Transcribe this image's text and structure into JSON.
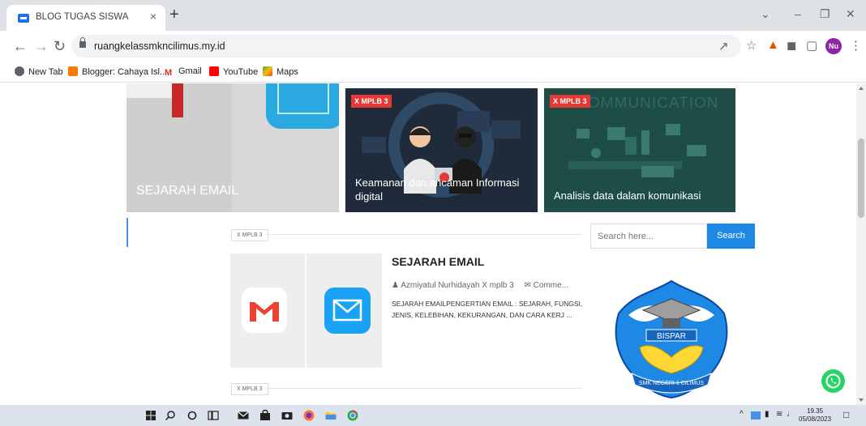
{
  "browser": {
    "tab_title": "BLOG TUGAS SISWA",
    "tab_close": "×",
    "new_tab": "+",
    "url": "ruangkelassmkncilimus.my.id",
    "profile_initials": "Nu",
    "bookmarks": [
      {
        "label": "New Tab",
        "icon": "globe-icon",
        "color": "#5f6368"
      },
      {
        "label": "Blogger: Cahaya Isl...",
        "icon": "blogger-icon",
        "color": "#f57c00"
      },
      {
        "label": "Gmail",
        "icon": "gmail-icon",
        "color": "#d93025"
      },
      {
        "label": "YouTube",
        "icon": "youtube-icon",
        "color": "#ff0000"
      },
      {
        "label": "Maps",
        "icon": "maps-icon",
        "color": "#34a853"
      }
    ]
  },
  "featured": [
    {
      "title": "SEJARAH EMAIL"
    },
    {
      "tag": "X MPLB 3",
      "title": "Keamanan dan ancaman Informasi digital"
    },
    {
      "tag": "X MPLB 3",
      "title": "Analisis data dalam komunikasi",
      "bg_word": "OMMUNICATION"
    }
  ],
  "section_label": "X MPLB 3",
  "search": {
    "placeholder": "Search here...",
    "button": "Search"
  },
  "post": {
    "title": "SEJARAH EMAIL",
    "author": "Azmiyatul Nurhidayah X mplb 3",
    "comments": "Comme...",
    "excerpt": "SEJARAH EMAILPENGERTIAN EMAIL : SEJARAH, FUNGSI, JENIS, KELEBIHAN, KEKURANGAN, DAN CARA KERJ ..."
  },
  "logo": {
    "banner": "BISPAR",
    "school": "SMK NEGERI 1 CILIMUS"
  },
  "taskbar": {
    "time": "19.35",
    "date": "05/08/2023"
  },
  "colors": {
    "accent": "#1e88e5",
    "tag_red": "#e53935",
    "whatsapp": "#25d366"
  }
}
